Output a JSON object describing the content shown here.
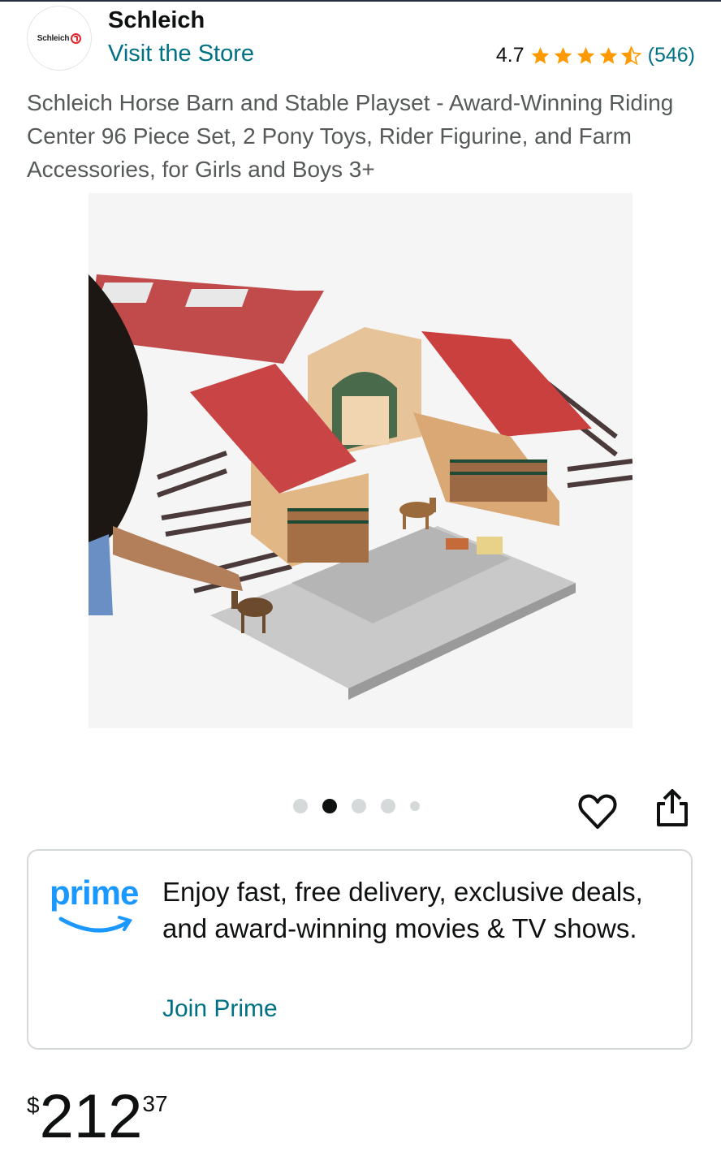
{
  "brand": {
    "logo_text": "Schleich",
    "name": "Schleich",
    "store_link": "Visit the Store"
  },
  "rating": {
    "value": "4.7",
    "stars": 4.5,
    "count": "(546)",
    "star_color": "#ff9900"
  },
  "product": {
    "title": "Schleich Horse Barn and Stable Playset - Award-Winning Riding Center 96 Piece Set, 2 Pony Toys, Rider Figurine, and Farm Accessories, for Girls and Boys 3+",
    "image_description_icon": "product-photo"
  },
  "carousel": {
    "dot_count": 5,
    "active_index": 1
  },
  "prime": {
    "logo_word": "prime",
    "text": "Enjoy fast, free delivery, exclusive deals, and award-winning movies & TV shows.",
    "join_label": "Join Prime",
    "brand_color": "#1a98ff"
  },
  "price": {
    "symbol": "$",
    "whole": "212",
    "fraction": "37"
  },
  "colors": {
    "link": "#007185",
    "text": "#0f1111",
    "muted": "#565959"
  }
}
